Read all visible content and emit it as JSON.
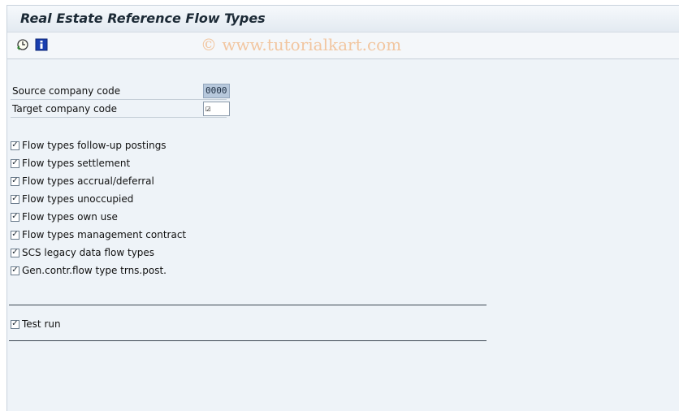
{
  "window": {
    "title": "Real Estate Reference Flow Types"
  },
  "toolbar": {
    "buttons": [
      {
        "name": "execute-icon",
        "icon": "clock-execute"
      },
      {
        "name": "info-icon",
        "icon": "info",
        "glyph": "i"
      }
    ],
    "watermark": "© www.tutorialkart.com"
  },
  "fields": {
    "source_company_code": {
      "label": "Source company code",
      "value": "0000"
    },
    "target_company_code": {
      "label": "Target company code",
      "value": "☑"
    }
  },
  "checkboxes": [
    {
      "label": "Flow types follow-up postings",
      "checked": true
    },
    {
      "label": "Flow types settlement",
      "checked": true
    },
    {
      "label": "Flow types accrual/deferral",
      "checked": true
    },
    {
      "label": "Flow types unoccupied",
      "checked": true
    },
    {
      "label": "Flow types own use",
      "checked": true
    },
    {
      "label": "Flow types management contract",
      "checked": true
    },
    {
      "label": "SCS legacy data flow types",
      "checked": true
    },
    {
      "label": "Gen.contr.flow type trns.post.",
      "checked": true
    }
  ],
  "test_run": {
    "label": "Test run",
    "checked": true
  },
  "colors": {
    "accent": "#b7c8dc",
    "background": "#eef3f8",
    "watermark": "#f2c6a0"
  }
}
